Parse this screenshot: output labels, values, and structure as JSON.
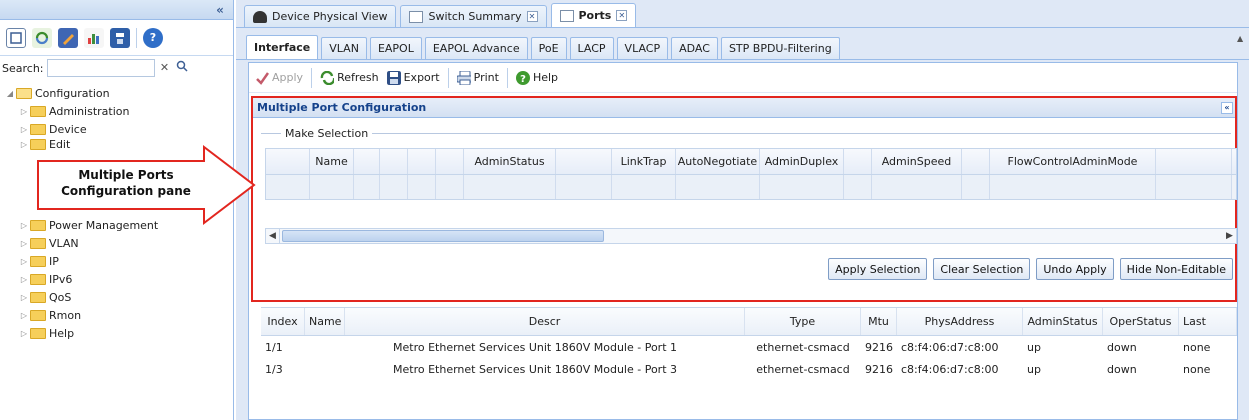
{
  "left_panel": {
    "collapse_glyph": "«",
    "toolbar_icons": [
      "window-icon",
      "refresh-icon",
      "edit-icon",
      "chart-icon",
      "save-icon",
      "help-icon"
    ],
    "search_label": "Search:",
    "search_value": "",
    "tree": {
      "root": "Configuration",
      "items": [
        "Administration",
        "Device",
        "Edit",
        "Power Management",
        "VLAN",
        "IP",
        "IPv6",
        "QoS",
        "Rmon",
        "Help"
      ]
    }
  },
  "doc_tabs": [
    {
      "label": "Device Physical View",
      "closable": false,
      "active": false
    },
    {
      "label": "Switch Summary",
      "closable": true,
      "active": false
    },
    {
      "label": "Ports",
      "closable": true,
      "active": true
    }
  ],
  "sub_tabs": [
    {
      "label": "Interface",
      "active": true
    },
    {
      "label": "VLAN",
      "active": false
    },
    {
      "label": "EAPOL",
      "active": false
    },
    {
      "label": "EAPOL Advance",
      "active": false
    },
    {
      "label": "PoE",
      "active": false
    },
    {
      "label": "LACP",
      "active": false
    },
    {
      "label": "VLACP",
      "active": false
    },
    {
      "label": "ADAC",
      "active": false
    },
    {
      "label": "STP BPDU-Filtering",
      "active": false
    }
  ],
  "actions": {
    "apply": "Apply",
    "refresh": "Refresh",
    "export": "Export",
    "print": "Print",
    "help": "Help"
  },
  "mpc": {
    "title": "Multiple Port Configuration",
    "make_selection": "Make Selection",
    "columns": [
      "",
      "Name",
      "",
      "",
      "",
      "",
      "AdminStatus",
      "",
      "LinkTrap",
      "AutoNegotiate",
      "AdminDuplex",
      "",
      "AdminSpeed",
      "",
      "FlowControlAdminMode",
      ""
    ],
    "buttons": {
      "apply_selection": "Apply Selection",
      "clear_selection": "Clear Selection",
      "undo_apply": "Undo Apply",
      "hide_non_editable": "Hide Non-Editable"
    }
  },
  "port_table": {
    "columns": [
      "Index",
      "Name",
      "Descr",
      "Type",
      "Mtu",
      "PhysAddress",
      "AdminStatus",
      "OperStatus",
      "Last"
    ],
    "rows": [
      [
        "1/1",
        "",
        "Metro Ethernet Services Unit 1860V Module - Port 1",
        "ethernet-csmacd",
        "9216",
        "c8:f4:06:d7:c8:00",
        "up",
        "down",
        "none"
      ],
      [
        "1/3",
        "",
        "Metro Ethernet Services Unit 1860V Module - Port 3",
        "ethernet-csmacd",
        "9216",
        "c8:f4:06:d7:c8:00",
        "up",
        "down",
        "none"
      ]
    ]
  },
  "callout": {
    "line1": "Multiple Ports",
    "line2": "Configuration pane"
  },
  "colors": {
    "accent_red": "#e2261f",
    "panel_blue": "#dfe8f6",
    "header_text": "#15428b"
  }
}
